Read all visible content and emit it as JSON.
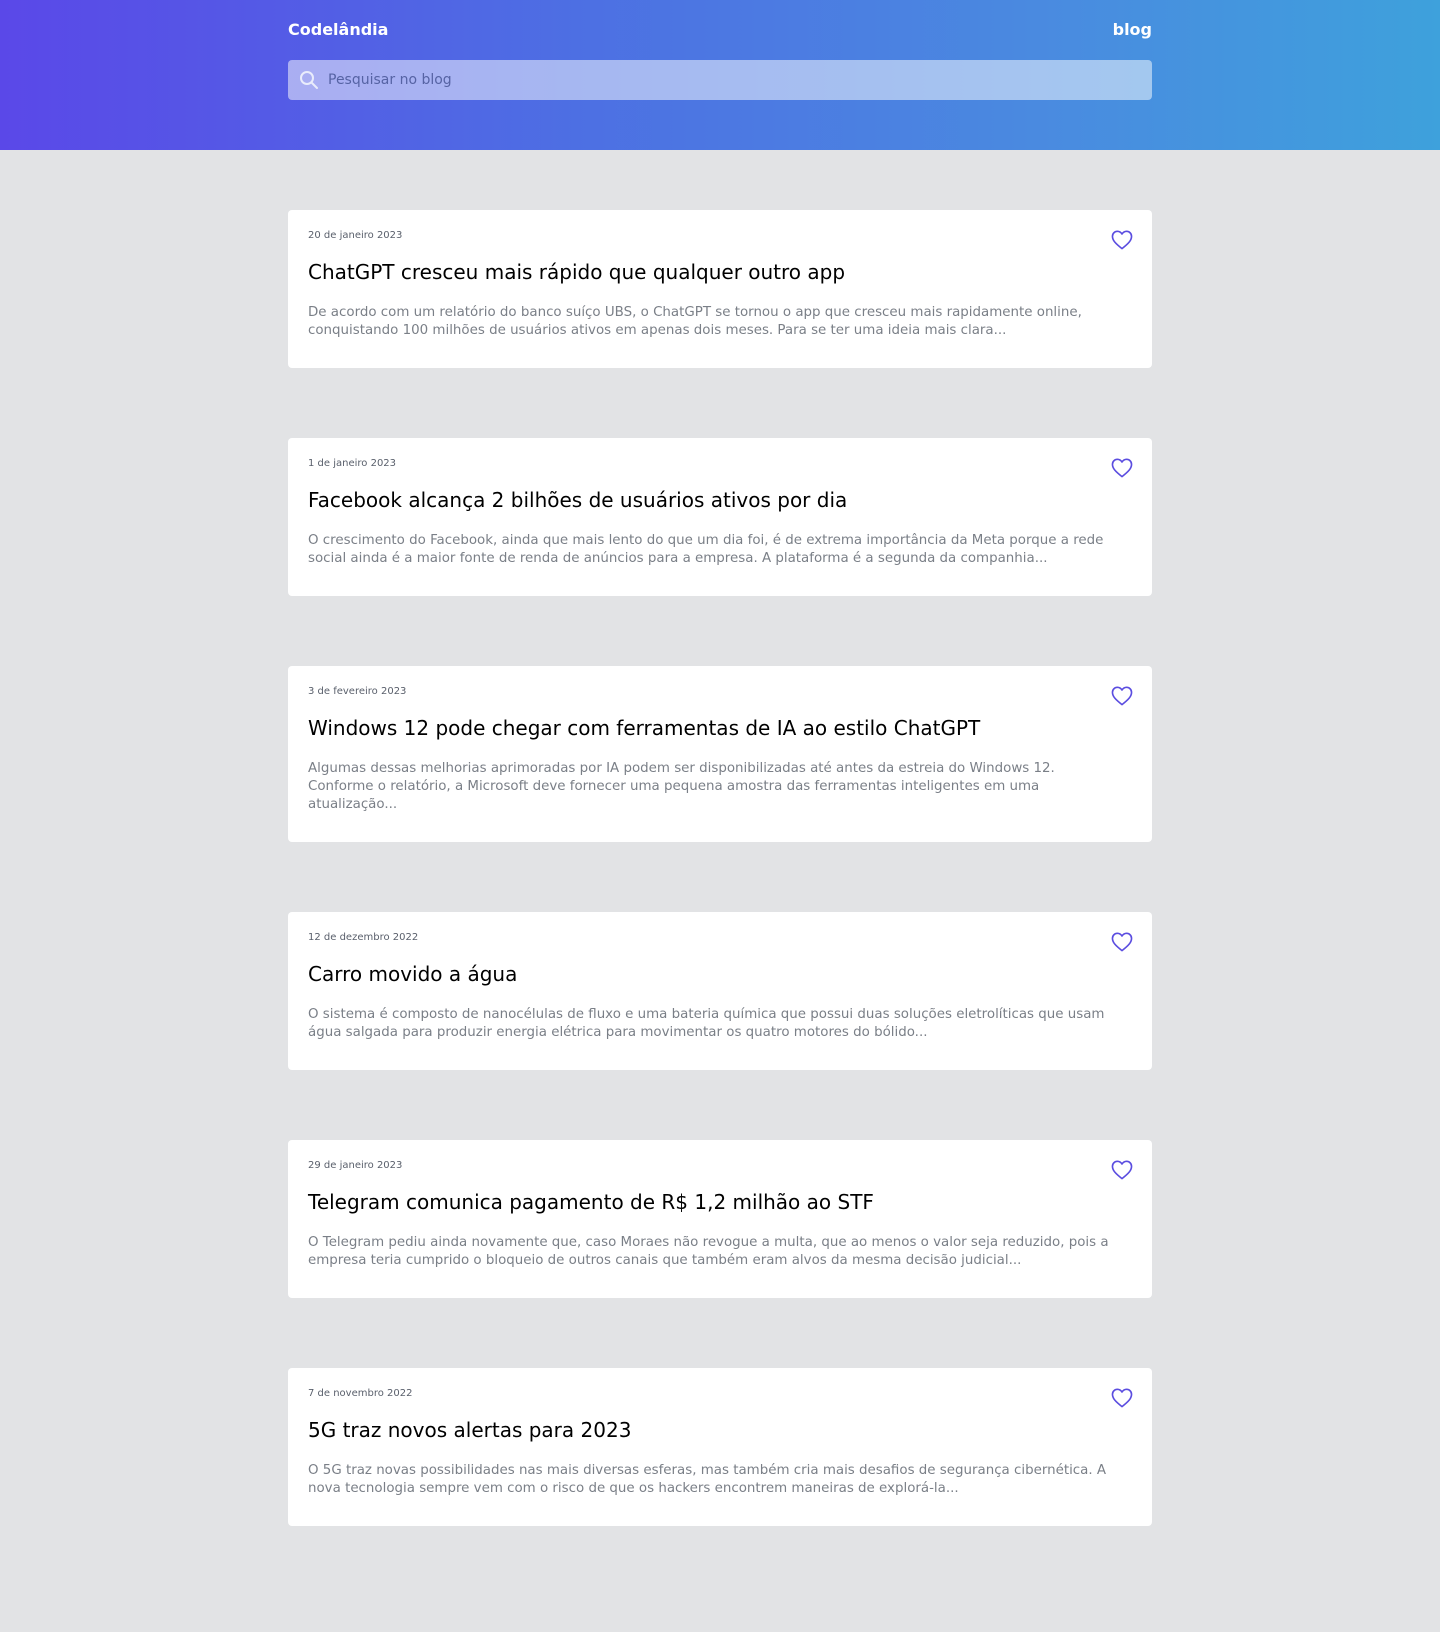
{
  "header": {
    "brand": "Codelândia",
    "nav_blog": "blog",
    "search_placeholder": "Pesquisar no blog",
    "search_value": ""
  },
  "colors": {
    "header_gradient_start": "#5a48e8",
    "header_gradient_end": "#3ea1dc",
    "page_background": "#e2e3e5",
    "heart": "#5b4de0"
  },
  "icons": {
    "search": "search-icon",
    "like": "heart-outline-icon"
  },
  "posts": [
    {
      "date": "20 de janeiro 2023",
      "title": "ChatGPT cresceu mais rápido que qualquer outro app",
      "excerpt": "De acordo com um relatório do banco suíço UBS, o ChatGPT se tornou o app que cresceu mais rapidamente online, conquistando 100 milhões de usuários ativos em apenas dois meses. Para se ter uma ideia mais clara..."
    },
    {
      "date": "1 de janeiro 2023",
      "title": "Facebook alcança 2 bilhões de usuários ativos por dia",
      "excerpt": "O crescimento do Facebook, ainda que mais lento do que um dia foi, é de extrema importância da Meta porque a rede social ainda é a maior fonte de renda de anúncios para a empresa. A plataforma é a segunda da companhia..."
    },
    {
      "date": "3 de fevereiro 2023",
      "title": "Windows 12 pode chegar com ferramentas de IA ao estilo ChatGPT",
      "excerpt": "Algumas dessas melhorias aprimoradas por IA podem ser disponibilizadas até antes da estreia do Windows 12. Conforme o relatório, a Microsoft deve fornecer uma pequena amostra das ferramentas inteligentes em uma atualização..."
    },
    {
      "date": "12 de dezembro 2022",
      "title": "Carro movido a água",
      "excerpt": "O sistema é composto de nanocélulas de fluxo e uma bateria química que possui duas soluções eletrolíticas que usam água salgada para produzir energia elétrica para movimentar os quatro motores do bólido..."
    },
    {
      "date": "29 de janeiro 2023",
      "title": "Telegram comunica pagamento de R$ 1,2 milhão ao STF",
      "excerpt": "O Telegram pediu ainda novamente que, caso Moraes não revogue a multa, que ao menos o valor seja reduzido, pois a empresa teria cumprido o bloqueio de outros canais que também eram alvos da mesma decisão judicial..."
    },
    {
      "date": "7 de novembro 2022",
      "title": "5G traz novos alertas para 2023",
      "excerpt": "O 5G traz novas possibilidades nas mais diversas esferas, mas também cria mais desafios de segurança cibernética. A nova tecnologia sempre vem com o risco de que os hackers encontrem maneiras de explorá-la..."
    }
  ]
}
